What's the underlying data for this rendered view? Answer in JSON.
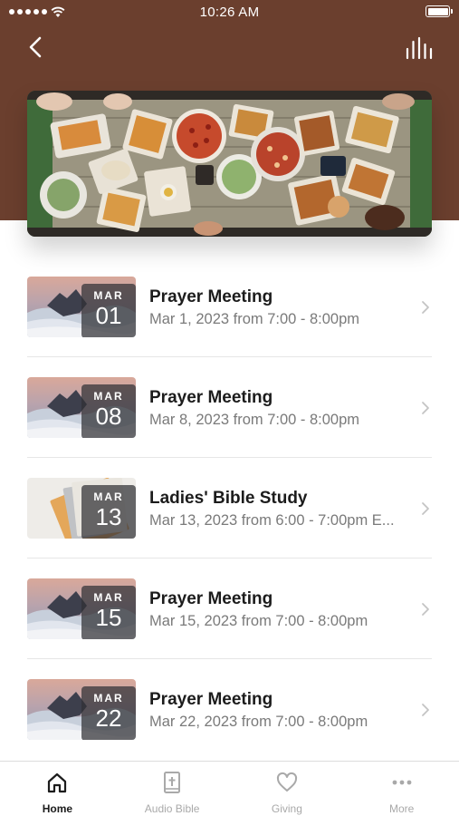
{
  "status_bar": {
    "time": "10:26 AM"
  },
  "header": {
    "back_icon": "chevron-left-icon",
    "action_icon": "equalizer-icon",
    "background_color": "#6b3f2e"
  },
  "hero": {
    "image": "table of food platters on wooden picnic table"
  },
  "events": [
    {
      "month": "MAR",
      "day": "01",
      "title": "Prayer Meeting",
      "subtitle": "Mar 1, 2023 from 7:00 - 8:00pm",
      "thumb": "mountains"
    },
    {
      "month": "MAR",
      "day": "08",
      "title": "Prayer Meeting",
      "subtitle": "Mar 8, 2023 from 7:00 - 8:00pm",
      "thumb": "mountains"
    },
    {
      "month": "MAR",
      "day": "13",
      "title": "Ladies' Bible Study",
      "subtitle": "Mar 13, 2023 from 6:00 - 7:00pm E...",
      "thumb": "notebook"
    },
    {
      "month": "MAR",
      "day": "15",
      "title": "Prayer Meeting",
      "subtitle": "Mar 15, 2023 from 7:00 - 8:00pm",
      "thumb": "mountains"
    },
    {
      "month": "MAR",
      "day": "22",
      "title": "Prayer Meeting",
      "subtitle": "Mar 22, 2023 from 7:00 - 8:00pm",
      "thumb": "mountains"
    }
  ],
  "tabs": [
    {
      "label": "Home",
      "icon": "home-icon",
      "active": true
    },
    {
      "label": "Audio Bible",
      "icon": "bible-icon",
      "active": false
    },
    {
      "label": "Giving",
      "icon": "heart-icon",
      "active": false
    },
    {
      "label": "More",
      "icon": "more-icon",
      "active": false
    }
  ]
}
